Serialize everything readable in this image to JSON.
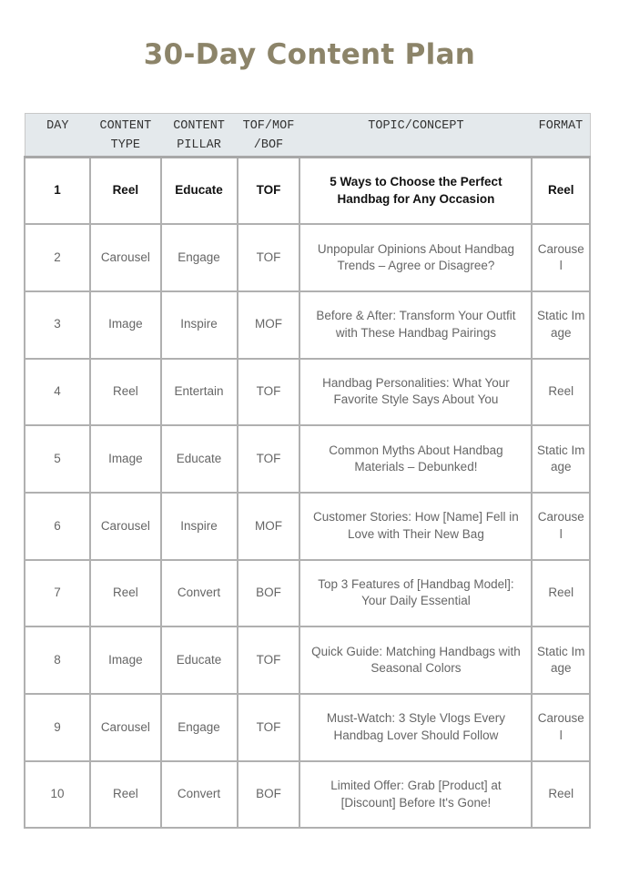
{
  "title": "30-Day Content Plan",
  "colors": {
    "title": "#8c8469",
    "header_bg": "#e4e9ec",
    "border": "#b0b0b0"
  },
  "table": {
    "headers": [
      "DAY",
      "CONTENT TYPE",
      "CONTENT PILLAR",
      "TOF/MOF /BOF",
      "TOPIC/CONCEPT",
      "FORMAT"
    ],
    "rows": [
      {
        "day": "1",
        "type": "Reel",
        "pillar": "Educate",
        "funnel": "TOF",
        "topic": "5 Ways to Choose the Perfect Handbag for Any Occasion",
        "format": "Reel",
        "highlight": true
      },
      {
        "day": "2",
        "type": "Carousel",
        "pillar": "Engage",
        "funnel": "TOF",
        "topic": "Unpopular Opinions About Handbag Trends – Agree or Disagree?",
        "format": "Carousel"
      },
      {
        "day": "3",
        "type": "Image",
        "pillar": "Inspire",
        "funnel": "MOF",
        "topic": "Before & After: Transform Your Outfit with These Handbag Pairings",
        "format": "Static Image"
      },
      {
        "day": "4",
        "type": "Reel",
        "pillar": "Entertain",
        "funnel": "TOF",
        "topic": "Handbag Personalities: What Your Favorite Style Says About You",
        "format": "Reel"
      },
      {
        "day": "5",
        "type": "Image",
        "pillar": "Educate",
        "funnel": "TOF",
        "topic": "Common Myths About Handbag Materials – Debunked!",
        "format": "Static Image"
      },
      {
        "day": "6",
        "type": "Carousel",
        "pillar": "Inspire",
        "funnel": "MOF",
        "topic": "Customer Stories: How [Name] Fell in Love with Their New Bag",
        "format": "Carousel"
      },
      {
        "day": "7",
        "type": "Reel",
        "pillar": "Convert",
        "funnel": "BOF",
        "topic": "Top 3 Features of [Handbag Model]: Your Daily Essential",
        "format": "Reel"
      },
      {
        "day": "8",
        "type": "Image",
        "pillar": "Educate",
        "funnel": "TOF",
        "topic": "Quick Guide: Matching Handbags with Seasonal Colors",
        "format": "Static Image"
      },
      {
        "day": "9",
        "type": "Carousel",
        "pillar": "Engage",
        "funnel": "TOF",
        "topic": "Must-Watch: 3 Style Vlogs Every Handbag Lover Should Follow",
        "format": "Carousel"
      },
      {
        "day": "10",
        "type": "Reel",
        "pillar": "Convert",
        "funnel": "BOF",
        "topic": "Limited Offer: Grab [Product] at [Discount] Before It's Gone!",
        "format": "Reel"
      }
    ]
  }
}
